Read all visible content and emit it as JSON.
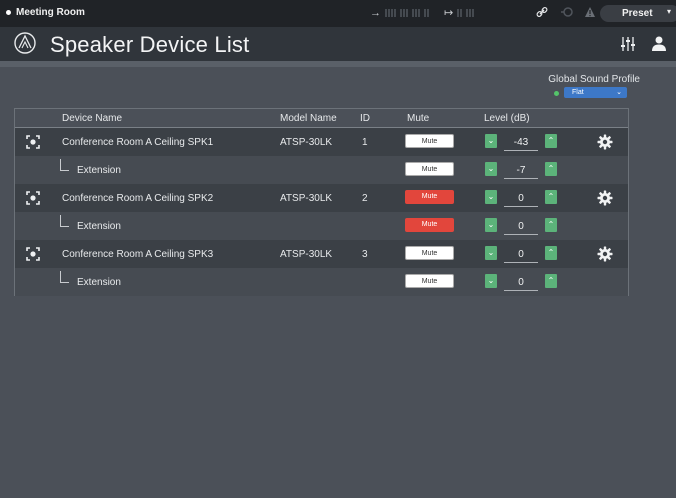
{
  "topbar": {
    "room_name": "Meeting Room",
    "input_icon": "input-arrow-icon",
    "output_icon": "output-arrow-icon",
    "link_icon": "link-icon",
    "mic_icon": "mic-signal-icon",
    "warning_icon": "warning-icon",
    "preset_label": "Preset"
  },
  "header": {
    "title": "Speaker Device List",
    "logo_icon": "audio-technica-logo-icon",
    "mixer_icon": "mixer-settings-icon",
    "user_icon": "user-icon"
  },
  "global_sound_profile": {
    "label": "Global Sound Profile",
    "selected": "Flat",
    "led_color": "#54c46a"
  },
  "table": {
    "headers": {
      "device_name": "Device Name",
      "model_name": "Model Name",
      "id": "ID",
      "mute": "Mute",
      "level": "Level (dB)"
    },
    "rows": [
      {
        "device_name": "Conference Room A Ceiling SPK1",
        "model_name": "ATSP-30LK",
        "id": "1",
        "mute_label": "Mute",
        "muted": false,
        "level": "-43",
        "extension": {
          "name": "Extension",
          "mute_label": "Mute",
          "muted": false,
          "level": "-7"
        }
      },
      {
        "device_name": "Conference Room A Ceiling SPK2",
        "model_name": "ATSP-30LK",
        "id": "2",
        "mute_label": "Mute",
        "muted": true,
        "level": "0",
        "extension": {
          "name": "Extension",
          "mute_label": "Mute",
          "muted": true,
          "level": "0"
        }
      },
      {
        "device_name": "Conference Room A Ceiling SPK3",
        "model_name": "ATSP-30LK",
        "id": "3",
        "mute_label": "Mute",
        "muted": false,
        "level": "0",
        "extension": {
          "name": "Extension",
          "mute_label": "Mute",
          "muted": false,
          "level": "0"
        }
      }
    ]
  },
  "colors": {
    "mute_active": "#e2463c",
    "level_button": "#5cb37a",
    "select_blue": "#3d78c7"
  }
}
